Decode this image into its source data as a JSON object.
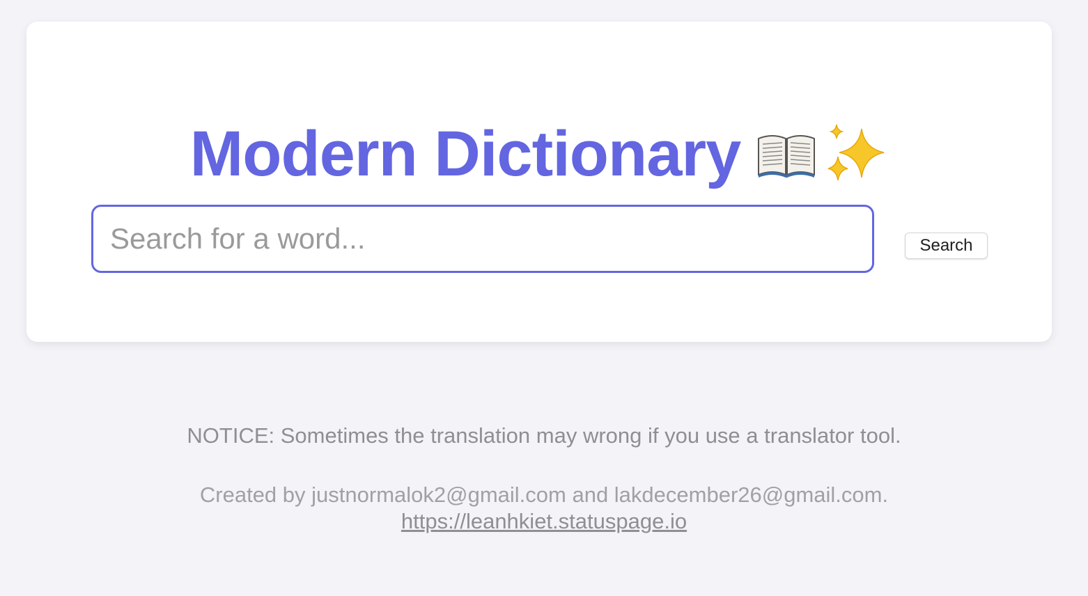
{
  "header": {
    "title": "Modern Dictionary",
    "icons": [
      "open-book-icon",
      "sparkles-icon"
    ]
  },
  "search": {
    "placeholder": "Search for a word...",
    "value": "",
    "button_label": "Search"
  },
  "footer": {
    "notice": "NOTICE: Sometimes the translation may wrong if you use a translator tool.",
    "credits": "Created by justnormalok2@gmail.com and lakdecember26@gmail.com.",
    "link_text": "https://leanhkiet.statuspage.io"
  },
  "colors": {
    "accent": "#6366e0",
    "background": "#f3f3f8",
    "card": "#ffffff",
    "muted_text": "#8e8e93",
    "sparkle": "#f5c518"
  }
}
